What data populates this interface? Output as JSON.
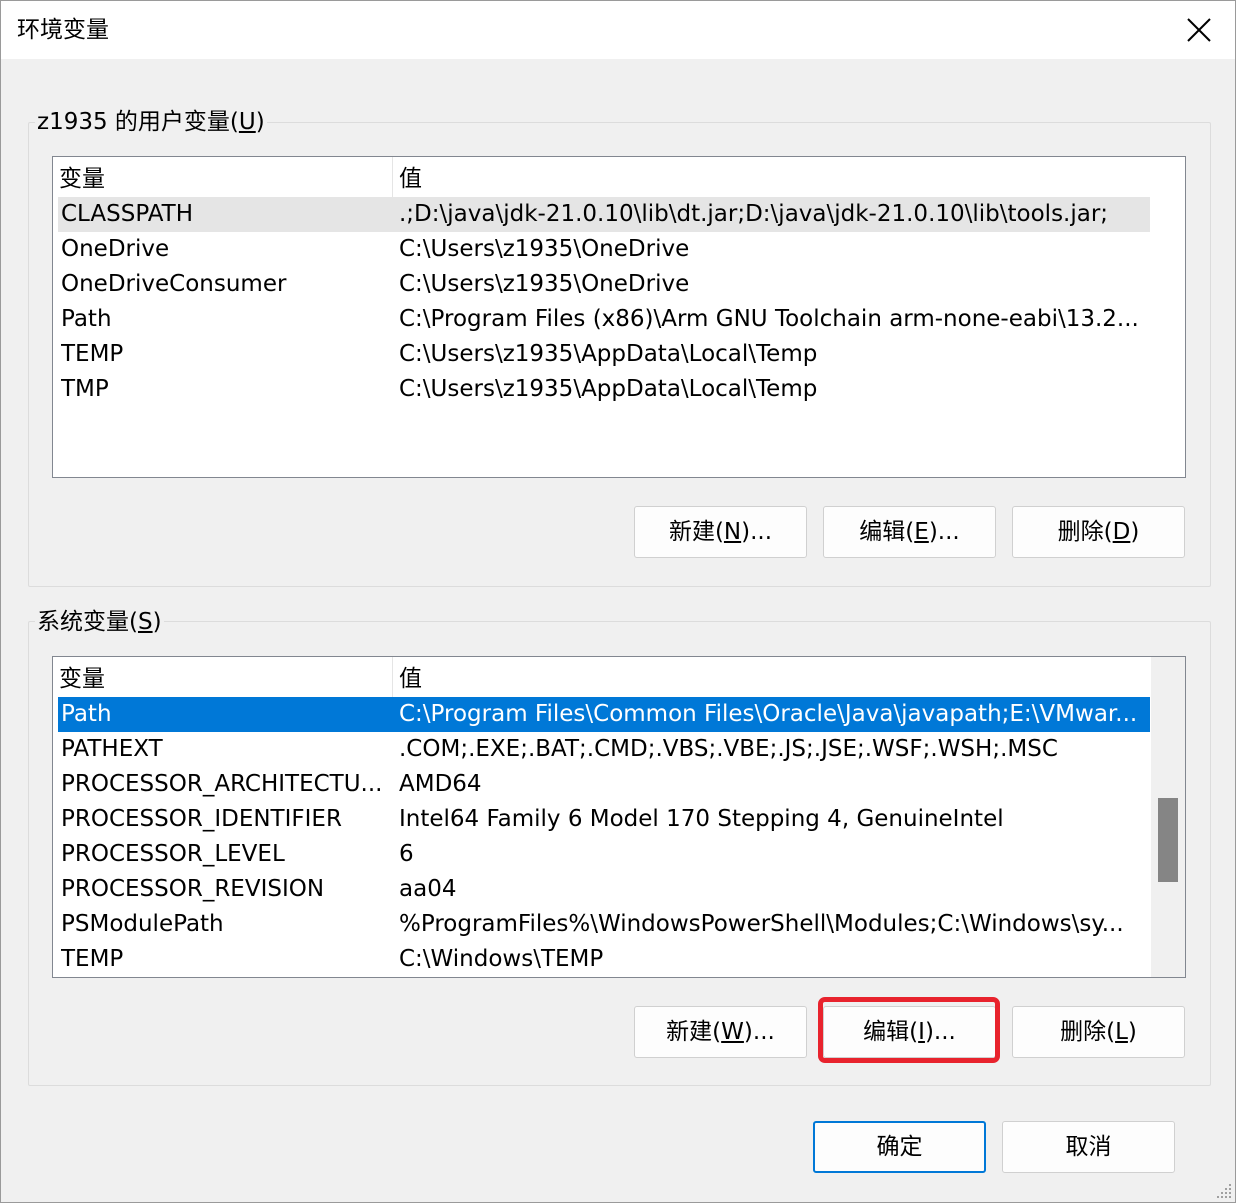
{
  "window": {
    "title": "环境变量",
    "close_icon": "close-icon"
  },
  "user_vars": {
    "group_label_prefix": "z1935 的用户变量(",
    "group_label_mnemonic": "U",
    "group_label_suffix": ")",
    "columns": [
      "变量",
      "值"
    ],
    "rows": [
      {
        "name": "CLASSPATH",
        "value": ".;D:\\java\\jdk-21.0.10\\lib\\dt.jar;D:\\java\\jdk-21.0.10\\lib\\tools.jar;"
      },
      {
        "name": "OneDrive",
        "value": "C:\\Users\\z1935\\OneDrive"
      },
      {
        "name": "OneDriveConsumer",
        "value": "C:\\Users\\z1935\\OneDrive"
      },
      {
        "name": "Path",
        "value": "C:\\Program Files (x86)\\Arm GNU Toolchain arm-none-eabi\\13.2..."
      },
      {
        "name": "TEMP",
        "value": "C:\\Users\\z1935\\AppData\\Local\\Temp"
      },
      {
        "name": "TMP",
        "value": "C:\\Users\\z1935\\AppData\\Local\\Temp"
      }
    ],
    "buttons": {
      "new": {
        "pre": "新建(",
        "key": "N",
        "post": ")..."
      },
      "edit": {
        "pre": "编辑(",
        "key": "E",
        "post": ")..."
      },
      "delete": {
        "pre": "删除(",
        "key": "D",
        "post": ")"
      }
    }
  },
  "system_vars": {
    "group_label_prefix": "系统变量(",
    "group_label_mnemonic": "S",
    "group_label_suffix": ")",
    "columns": [
      "变量",
      "值"
    ],
    "rows": [
      {
        "name": "Path",
        "value": "C:\\Program Files\\Common Files\\Oracle\\Java\\javapath;E:\\VMwar..."
      },
      {
        "name": "PATHEXT",
        "value": ".COM;.EXE;.BAT;.CMD;.VBS;.VBE;.JS;.JSE;.WSF;.WSH;.MSC"
      },
      {
        "name": "PROCESSOR_ARCHITECTU...",
        "value": "AMD64"
      },
      {
        "name": "PROCESSOR_IDENTIFIER",
        "value": "Intel64 Family 6 Model 170 Stepping 4, GenuineIntel"
      },
      {
        "name": "PROCESSOR_LEVEL",
        "value": "6"
      },
      {
        "name": "PROCESSOR_REVISION",
        "value": "aa04"
      },
      {
        "name": "PSModulePath",
        "value": "%ProgramFiles%\\WindowsPowerShell\\Modules;C:\\Windows\\sy..."
      },
      {
        "name": "TEMP",
        "value": "C:\\Windows\\TEMP"
      }
    ],
    "buttons": {
      "new": {
        "pre": "新建(",
        "key": "W",
        "post": ")..."
      },
      "edit": {
        "pre": "编辑(",
        "key": "I",
        "post": ")..."
      },
      "delete": {
        "pre": "删除(",
        "key": "L",
        "post": ")"
      }
    }
  },
  "footer": {
    "ok": "确定",
    "cancel": "取消"
  },
  "colors": {
    "selection": "#0078d7",
    "highlight_annotation": "#e8232d"
  }
}
